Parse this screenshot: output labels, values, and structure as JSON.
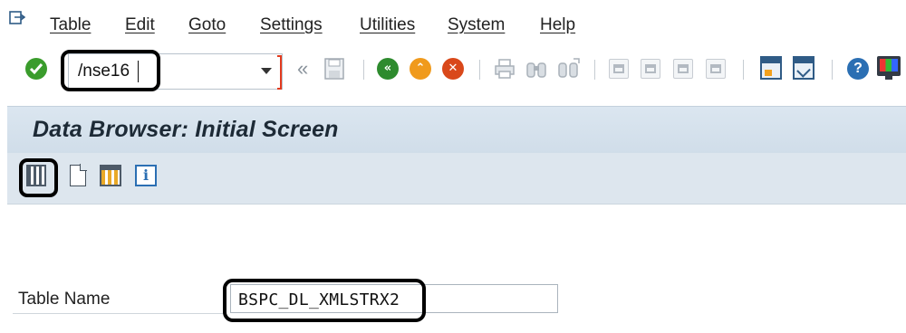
{
  "menubar": {
    "items": [
      {
        "label": "Table"
      },
      {
        "label": "Edit"
      },
      {
        "label": "Goto"
      },
      {
        "label": "Settings"
      },
      {
        "label": "Utilities"
      },
      {
        "label": "System"
      },
      {
        "label": "Help"
      }
    ]
  },
  "toolbar": {
    "command_value": "/nse16",
    "back_glyph": "«"
  },
  "screen": {
    "title": "Data Browser: Initial Screen",
    "info_glyph": "i"
  },
  "form": {
    "table_name_label": "Table Name",
    "table_name_value": "BSPC_DL_XMLSTRX2"
  },
  "icons": {
    "exit": "exit-menu-icon",
    "ok": "check-icon",
    "save": "save-icon",
    "back": "back-icon",
    "exit_nav": "exit-icon",
    "cancel": "cancel-icon",
    "print": "print-icon",
    "find": "find-icon",
    "find_next": "find-next-icon",
    "help": "help-icon",
    "layout": "layout-icon",
    "execute": "execute-icon",
    "new": "new-entries-icon",
    "table_contents": "table-contents-icon",
    "info": "info-icon"
  },
  "colors": {
    "ok": "#3a9c2c",
    "back": "#2e8b2e",
    "exit": "#f09a1c",
    "cancel": "#d9481a",
    "header_bg": "#d6e1ec",
    "highlight": "#000000"
  }
}
